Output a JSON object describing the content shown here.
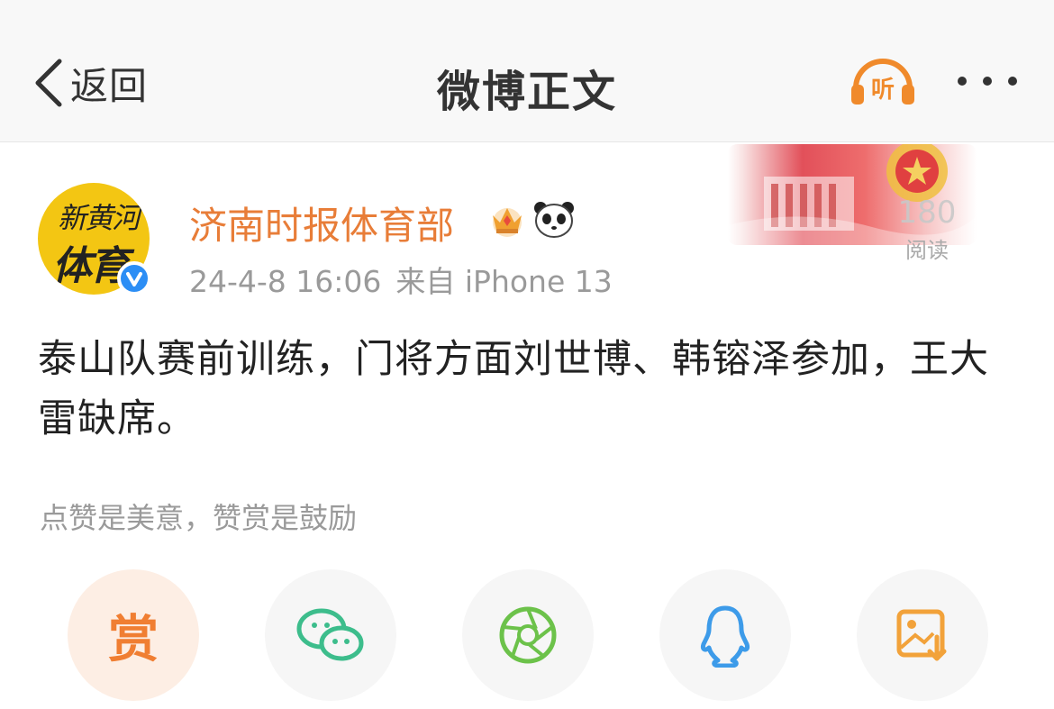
{
  "nav": {
    "back_label": "返回",
    "title": "微博正文",
    "listen_label": "听"
  },
  "post": {
    "read_count": "180",
    "read_label": "阅读",
    "avatar_text": [
      "新黄河",
      "体育"
    ],
    "author": "济南时报体育部",
    "date": "24-4-8 16:06",
    "source": "来自 iPhone 13",
    "content": "泰山队赛前训练，门将方面刘世博、韩镕泽参加，王大雷缺席。"
  },
  "reward": {
    "hint": "点赞是美意，赞赏是鼓励",
    "button_label": "赏"
  },
  "colors": {
    "accent": "#e87d38",
    "reward_orange": "#f07e32",
    "wechat_green": "#3dbd8c",
    "moments_green": "#6cc24a",
    "qq_blue": "#3d9be9",
    "save_orange": "#f2a23a"
  },
  "icons": [
    "back-chevron-icon",
    "headphones-icon",
    "more-icon",
    "crown-icon",
    "panda-icon",
    "wechat-icon",
    "moments-icon",
    "qq-icon",
    "save-image-icon"
  ]
}
